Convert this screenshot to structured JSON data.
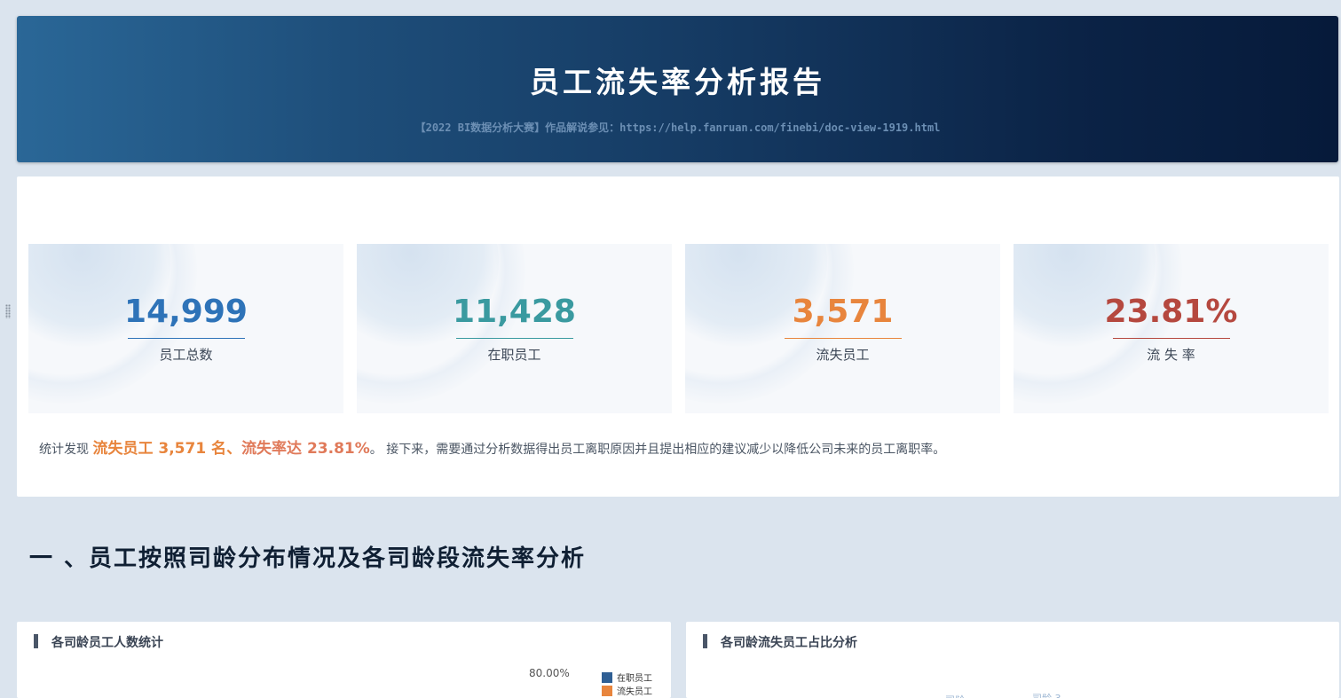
{
  "banner": {
    "title": "员工流失率分析报告",
    "subtitle": "【2022 BI数据分析大赛】作品解说参见：https://help.fanruan.com/finebi/doc-view-1919.html"
  },
  "kpis": [
    {
      "value": "14,999",
      "label": "员工总数",
      "color": "#2e73b8"
    },
    {
      "value": "11,428",
      "label": "在职员工",
      "color": "#3a9aa0"
    },
    {
      "value": "3,571",
      "label": "流失员工",
      "color": "#e8853d"
    },
    {
      "value": "23.81%",
      "label": "流 失 率",
      "color": "#b5483f"
    }
  ],
  "summary": {
    "prefix": "统计发现 ",
    "highlight1": "流失员工 3,571 名",
    "separator": "、",
    "highlight2": "流失率达 23.81%",
    "suffix": "。 接下来，需要通过分析数据得出员工离职原因并且提出相应的建议减少以降低公司未来的员工离职率。"
  },
  "section": {
    "title": "一 、员工按照司龄分布情况及各司龄段流失率分析"
  },
  "card_left": {
    "title": "各司龄员工人数统计",
    "axis_label": "80.00%",
    "legend": [
      {
        "label": "在职员工",
        "color": "#2f5f94"
      },
      {
        "label": "流失员工",
        "color": "#e8853d"
      }
    ]
  },
  "card_right": {
    "title": "各司龄流失员工占比分析",
    "faint_labels": [
      "司龄",
      "司龄 3"
    ]
  }
}
